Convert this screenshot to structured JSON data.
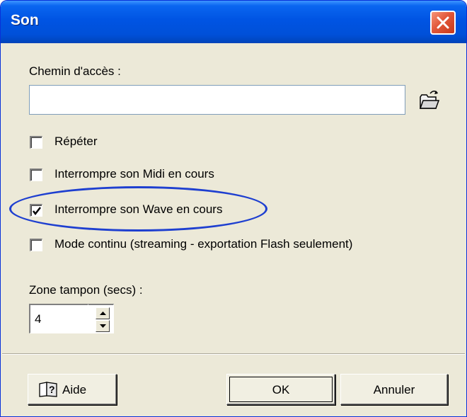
{
  "window": {
    "title": "Son"
  },
  "path": {
    "label": "Chemin d'accès :",
    "value": "",
    "browse_icon": "open-folder-icon"
  },
  "options": [
    {
      "label": "Répéter",
      "checked": false
    },
    {
      "label": "Interrompre son Midi en cours",
      "checked": false
    },
    {
      "label": "Interrompre son Wave en cours",
      "checked": true
    },
    {
      "label": "Mode continu (streaming - exportation Flash seulement)",
      "checked": false
    }
  ],
  "buffer": {
    "label": "Zone tampon (secs) :",
    "value": "4"
  },
  "buttons": {
    "help": "Aide",
    "ok": "OK",
    "cancel": "Annuler"
  },
  "colors": {
    "title_bar": "#0054e3",
    "close_button": "#e2583a",
    "dialog_background": "#ece9d8",
    "annotation_ellipse": "#1e3fd0"
  }
}
